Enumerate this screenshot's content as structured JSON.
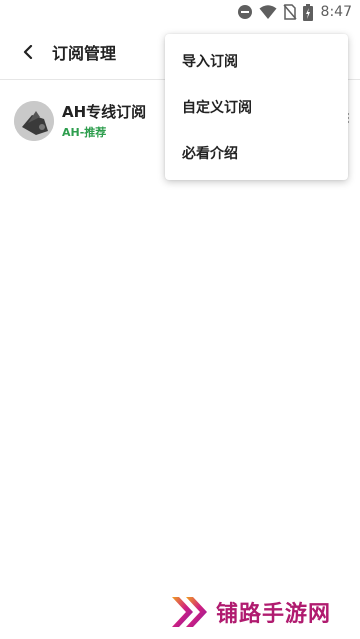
{
  "status_bar": {
    "time": "8:47",
    "icons": [
      "do-not-disturb-icon",
      "wifi-icon",
      "no-sim-icon",
      "battery-charging-icon"
    ]
  },
  "app_bar": {
    "title": "订阅管理",
    "back_icon": "back-arrow-icon"
  },
  "subscriptions": [
    {
      "title": "AH专线订阅",
      "subtitle": "AH-推荐",
      "subtitle_color": "#2e9e4e"
    }
  ],
  "menu": {
    "items": [
      {
        "label": "导入订阅"
      },
      {
        "label": "自定义订阅"
      },
      {
        "label": "必看介绍"
      }
    ]
  },
  "watermark": {
    "text": "铺路手游网",
    "color": "#b01b6f"
  }
}
